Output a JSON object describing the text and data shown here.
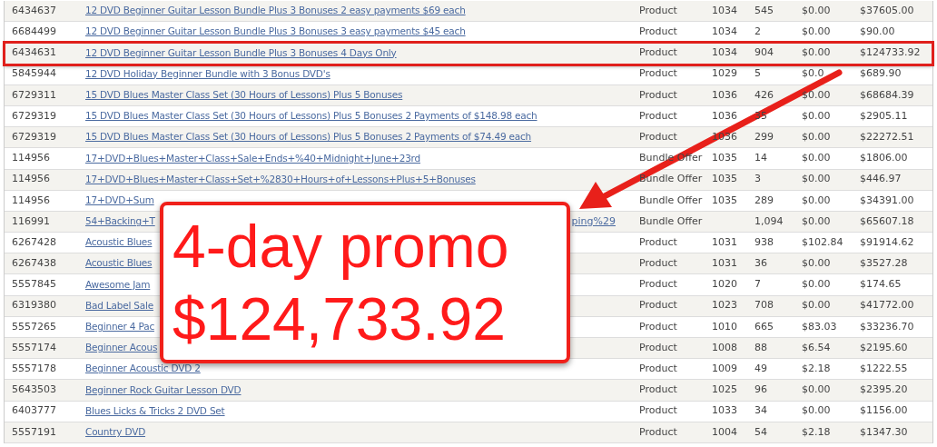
{
  "rows": [
    {
      "id": "6434637",
      "name": "12 DVD Beginner Guitar Lesson Bundle Plus 3 Bonuses 2 easy payments $69 each",
      "type": "Product",
      "code": "1034",
      "qty": "545",
      "price": "$0.00",
      "total": "$37605.00",
      "highlighted": false
    },
    {
      "id": "6684499",
      "name": "12 DVD Beginner Guitar Lesson Bundle Plus 3 Bonuses 3 easy payments $45 each",
      "type": "Product",
      "code": "1034",
      "qty": "2",
      "price": "$0.00",
      "total": "$90.00",
      "highlighted": false
    },
    {
      "id": "6434631",
      "name": "12 DVD Beginner Guitar Lesson Bundle Plus 3 Bonuses 4 Days Only",
      "type": "Product",
      "code": "1034",
      "qty": "904",
      "price": "$0.00",
      "total": "$124733.92",
      "highlighted": true
    },
    {
      "id": "5845944",
      "name": "12 DVD Holiday Beginner Bundle with 3 Bonus DVD's",
      "type": "Product",
      "code": "1029",
      "qty": "5",
      "price": "$0.0",
      "total": "$689.90",
      "highlighted": false
    },
    {
      "id": "6729311",
      "name": "15 DVD Blues Master Class Set (30 Hours of Lessons) Plus 5 Bonuses",
      "type": "Product",
      "code": "1036",
      "qty": "426",
      "price": "$0.00",
      "total": "$68684.39",
      "highlighted": false
    },
    {
      "id": "6729319",
      "name": "15 DVD Blues Master Class Set (30 Hours of Lessons) Plus 5 Bonuses 2 Payments of $148.98 each",
      "type": "Product",
      "code": "1036",
      "qty": "35",
      "price": "$0.00",
      "total": "$2905.11",
      "highlighted": false
    },
    {
      "id": "6729319",
      "name": "15 DVD Blues Master Class Set (30 Hours of Lessons) Plus 5 Bonuses 2 Payments of $74.49 each",
      "type": "Product",
      "code": "1036",
      "qty": "299",
      "price": "$0.00",
      "total": "$22272.51",
      "highlighted": false
    },
    {
      "id": "114956",
      "name": "17+DVD+Blues+Master+Class+Sale+Ends+%40+Midnight+June+23rd",
      "type": "Bundle Offer",
      "code": "1035",
      "qty": "14",
      "price": "$0.00",
      "total": "$1806.00",
      "highlighted": false
    },
    {
      "id": "114956",
      "name": "17+DVD+Blues+Master+Class+Set+%2830+Hours+of+Lessons+Plus+5+Bonuses",
      "type": "Bundle Offer",
      "code": "1035",
      "qty": "3",
      "price": "$0.00",
      "total": "$446.97",
      "highlighted": false
    },
    {
      "id": "114956",
      "name": "17+DVD+Sum",
      "type": "Bundle Offer",
      "code": "1035",
      "qty": "289",
      "price": "$0.00",
      "total": "$34391.00",
      "highlighted": false
    },
    {
      "id": "116991",
      "name": "54+Backing+T",
      "name_tail": "ping%29",
      "type": "Bundle Offer",
      "qty": "1,094",
      "price": "$0.00",
      "total": "$65607.18",
      "highlighted": false
    },
    {
      "id": "6267428",
      "name": "Acoustic Blues",
      "type": "Product",
      "code": "1031",
      "qty": "938",
      "price": "$102.84",
      "total": "$91914.62",
      "highlighted": false
    },
    {
      "id": "6267438",
      "name": "Acoustic Blues",
      "type": "Product",
      "code": "1031",
      "qty": "36",
      "price": "$0.00",
      "total": "$3527.28",
      "highlighted": false
    },
    {
      "id": "5557845",
      "name": "Awesome Jam",
      "type": "Product",
      "code": "1020",
      "qty": "7",
      "price": "$0.00",
      "total": "$174.65",
      "highlighted": false
    },
    {
      "id": "6319380",
      "name": "Bad Label Sale",
      "type": "Product",
      "code": "1023",
      "qty": "708",
      "price": "$0.00",
      "total": "$41772.00",
      "highlighted": false
    },
    {
      "id": "5557265",
      "name": "Beginner 4 Pac",
      "type": "Product",
      "code": "1010",
      "qty": "665",
      "price": "$83.03",
      "total": "$33236.70",
      "highlighted": false
    },
    {
      "id": "5557174",
      "name": "Beginner Acous",
      "type": "Product",
      "code": "1008",
      "qty": "88",
      "price": "$6.54",
      "total": "$2195.60",
      "highlighted": false
    },
    {
      "id": "5557178",
      "name": "Beginner Acoustic DVD 2",
      "type": "Product",
      "code": "1009",
      "qty": "49",
      "price": "$2.18",
      "total": "$1222.55",
      "highlighted": false
    },
    {
      "id": "5643503",
      "name": "Beginner Rock Guitar Lesson DVD",
      "type": "Product",
      "code": "1025",
      "qty": "96",
      "price": "$0.00",
      "total": "$2395.20",
      "highlighted": false
    },
    {
      "id": "6403777",
      "name": "Blues Licks & Tricks 2 DVD Set",
      "type": "Product",
      "code": "1033",
      "qty": "34",
      "price": "$0.00",
      "total": "$1156.00",
      "highlighted": false
    },
    {
      "id": "5557191",
      "name": "Country DVD",
      "type": "Product",
      "code": "1004",
      "qty": "54",
      "price": "$2.18",
      "total": "$1347.30",
      "highlighted": false
    }
  ],
  "callout": {
    "lines": [
      "4-day promo",
      "$124,733.92"
    ]
  }
}
